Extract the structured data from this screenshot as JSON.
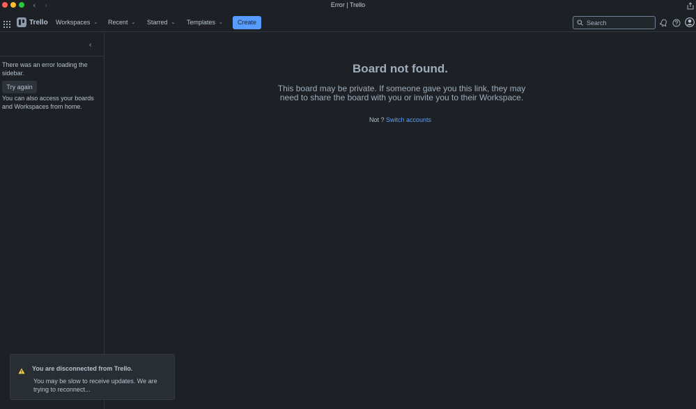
{
  "window": {
    "title": "Error | Trello"
  },
  "header": {
    "logo_text": "Trello",
    "menus": {
      "workspaces": "Workspaces",
      "recent": "Recent",
      "starred": "Starred",
      "templates": "Templates"
    },
    "create_label": "Create",
    "search_placeholder": "Search"
  },
  "sidebar": {
    "error_text": "There was an error loading the sidebar.",
    "try_again_label": "Try again",
    "hint_text": "You can also access your boards and Workspaces from home."
  },
  "main": {
    "title": "Board not found.",
    "description": "This board may be private. If someone gave you this link, they may need to share the board with you or invite you to their Workspace.",
    "not_prefix": "Not ?",
    "switch_link": "Switch accounts"
  },
  "toast": {
    "title": "You are disconnected from Trello.",
    "body": "You may be slow to receive updates. We are trying to reconnect..."
  },
  "colors": {
    "background": "#1d2125",
    "accent": "#579dff",
    "warning": "#f5cd47"
  }
}
